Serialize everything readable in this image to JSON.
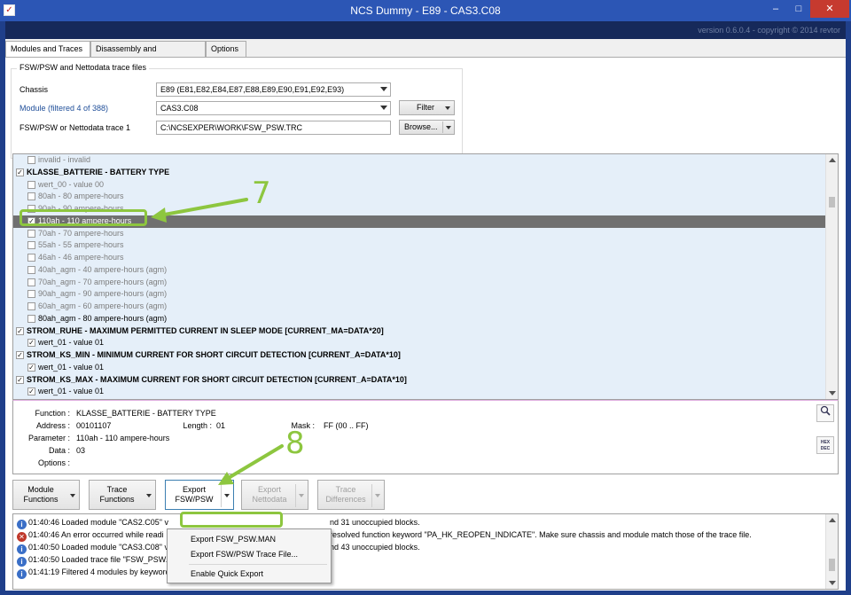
{
  "window": {
    "title": "NCS Dummy  -  E89  -  CAS3.C08",
    "version": "version 0.6.0.4 - copyright © 2014 revtor"
  },
  "tabs": [
    "Modules and Traces",
    "Disassembly and Checksums",
    "Options"
  ],
  "groupbox": {
    "title": "FSW/PSW and Nettodata trace files",
    "chassis_label": "Chassis",
    "chassis_value": "E89  (E81,E82,E84,E87,E88,E89,E90,E91,E92,E93)",
    "module_label": "Module (filtered 4 of 388)",
    "module_value": "CAS3.C08",
    "trace_label": "FSW/PSW or Nettodata trace 1",
    "trace_value": "C:\\NCSEXPER\\WORK\\FSW_PSW.TRC",
    "filter_label": "Filter",
    "browse_label": "Browse..."
  },
  "tree": [
    {
      "indent": 2,
      "checked": false,
      "style": "grey",
      "text": "invalid  -  invalid"
    },
    {
      "indent": 1,
      "checked": true,
      "style": "bold",
      "text": "KLASSE_BATTERIE  -  BATTERY TYPE"
    },
    {
      "indent": 2,
      "checked": false,
      "style": "grey",
      "text": "wert_00  -  value 00"
    },
    {
      "indent": 2,
      "checked": false,
      "style": "grey",
      "text": "80ah  -  80 ampere-hours"
    },
    {
      "indent": 2,
      "checked": false,
      "style": "grey",
      "text": "90ah  -  90 ampere-hours"
    },
    {
      "indent": 2,
      "checked": true,
      "style": "sel",
      "text": "110ah  -  110 ampere-hours"
    },
    {
      "indent": 2,
      "checked": false,
      "style": "grey",
      "text": "70ah  -  70 ampere-hours"
    },
    {
      "indent": 2,
      "checked": false,
      "style": "grey",
      "text": "55ah  -  55 ampere-hours"
    },
    {
      "indent": 2,
      "checked": false,
      "style": "grey",
      "text": "46ah  -  46 ampere-hours"
    },
    {
      "indent": 2,
      "checked": false,
      "style": "grey",
      "text": "40ah_agm  -  40 ampere-hours (agm)"
    },
    {
      "indent": 2,
      "checked": false,
      "style": "grey",
      "text": "70ah_agm  -  70 ampere-hours (agm)"
    },
    {
      "indent": 2,
      "checked": false,
      "style": "grey",
      "text": "90ah_agm  -  90 ampere-hours (agm)"
    },
    {
      "indent": 2,
      "checked": false,
      "style": "grey",
      "text": "60ah_agm  -  60 ampere-hours (agm)"
    },
    {
      "indent": 2,
      "checked": false,
      "style": "normal",
      "text": "80ah_agm  -  80 ampere-hours (agm)"
    },
    {
      "indent": 1,
      "checked": true,
      "style": "bold",
      "text": "STROM_RUHE  -  MAXIMUM PERMITTED CURRENT IN SLEEP MODE [CURRENT_MA=DATA*20]"
    },
    {
      "indent": 2,
      "checked": true,
      "style": "normal",
      "text": "wert_01  -  value 01"
    },
    {
      "indent": 1,
      "checked": true,
      "style": "bold",
      "text": "STROM_KS_MIN  -  MINIMUM CURRENT FOR SHORT CIRCUIT DETECTION [CURRENT_A=DATA*10]"
    },
    {
      "indent": 2,
      "checked": true,
      "style": "normal",
      "text": "wert_01  -  value 01"
    },
    {
      "indent": 1,
      "checked": true,
      "style": "bold",
      "text": "STROM_KS_MAX  -  MAXIMUM CURRENT FOR SHORT CIRCUIT DETECTION [CURRENT_A=DATA*10]"
    },
    {
      "indent": 2,
      "checked": true,
      "style": "normal",
      "text": "wert_01  -  value 01"
    }
  ],
  "details": {
    "function_label": "Function :",
    "function_value": "KLASSE_BATTERIE  -  BATTERY TYPE",
    "address_label": "Address :",
    "address_value": "00101107",
    "length_label": "Length :",
    "length_value": "01",
    "mask_label": "Mask :",
    "mask_value": "FF  (00 .. FF)",
    "parameter_label": "Parameter :",
    "parameter_value": "110ah  -  110 ampere-hours",
    "data_label": "Data :",
    "data_value": "03",
    "options_label": "Options :",
    "hexdec_label": "HEX DEC"
  },
  "toolbar": {
    "module_functions": [
      "Module",
      "Functions"
    ],
    "trace_functions": [
      "Trace",
      "Functions"
    ],
    "export_fswpsw": [
      "Export",
      "FSW/PSW"
    ],
    "export_nettodata": [
      "Export",
      "Nettodata"
    ],
    "trace_differences": [
      "Trace",
      "Differences"
    ]
  },
  "menu": [
    "Export FSW_PSW.MAN",
    "Export FSW/PSW Trace File...",
    "Enable Quick Export"
  ],
  "log": [
    {
      "type": "info",
      "text": "01:40:46  Loaded module \"CAS2.C05\" v",
      "tail": "nd 31 unoccupied blocks."
    },
    {
      "type": "err",
      "text": "01:40:46  An error occurred while readi",
      "tail": "resolved function keyword \"PA_HK_REOPEN_INDICATE\". Make sure chassis and module match those of the trace file."
    },
    {
      "type": "info",
      "text": "01:40:50  Loaded module \"CAS3.C08\" v",
      "tail": "nd 43 unoccupied blocks."
    },
    {
      "type": "info",
      "text": "01:40:50  Loaded trace file \"FSW_PSW.TRC\" with 249 functions.",
      "tail": ""
    },
    {
      "type": "info",
      "text": "01:41:19  Filtered 4 modules by keyword.",
      "tail": ""
    }
  ],
  "annotations": {
    "step7": "7",
    "step8": "8"
  },
  "colors": {
    "annotation": "#8dc63f",
    "titlebar": "#2c56b5",
    "selected_row": "#707070"
  }
}
